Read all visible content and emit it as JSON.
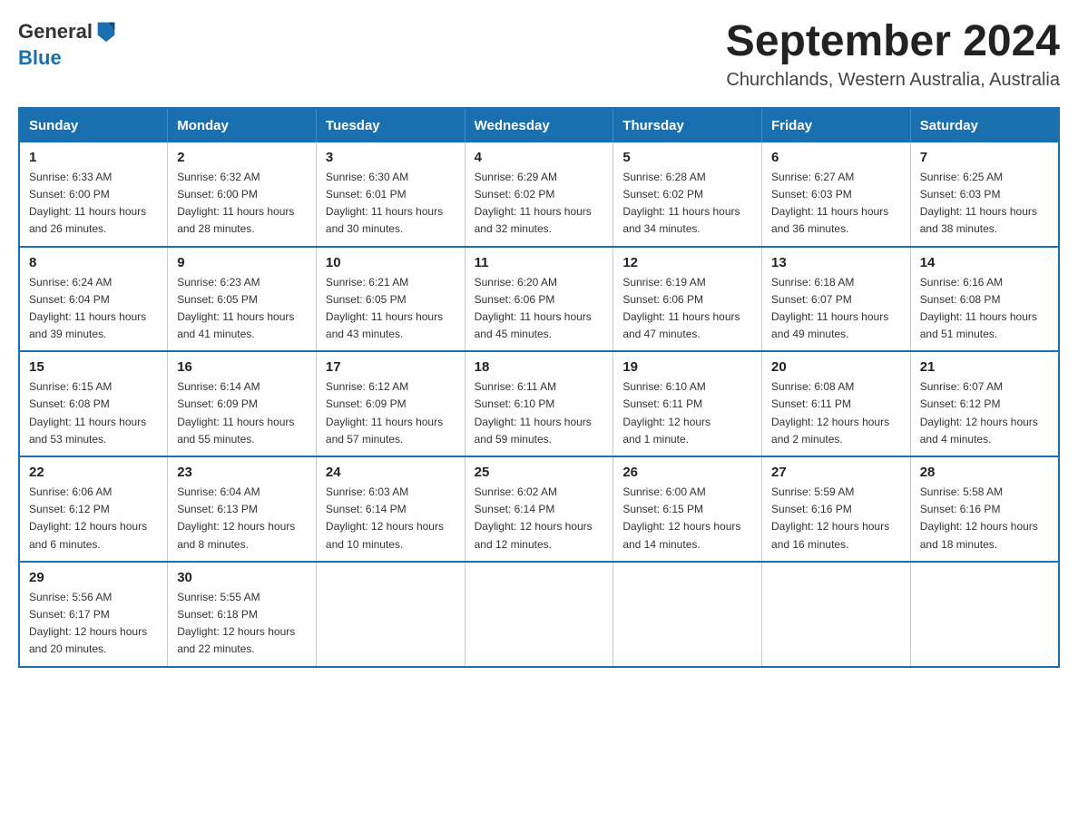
{
  "logo": {
    "text_general": "General",
    "text_blue": "Blue"
  },
  "title": "September 2024",
  "location": "Churchlands, Western Australia, Australia",
  "days_of_week": [
    "Sunday",
    "Monday",
    "Tuesday",
    "Wednesday",
    "Thursday",
    "Friday",
    "Saturday"
  ],
  "weeks": [
    [
      {
        "day": "1",
        "sunrise": "6:33 AM",
        "sunset": "6:00 PM",
        "daylight": "11 hours and 26 minutes."
      },
      {
        "day": "2",
        "sunrise": "6:32 AM",
        "sunset": "6:00 PM",
        "daylight": "11 hours and 28 minutes."
      },
      {
        "day": "3",
        "sunrise": "6:30 AM",
        "sunset": "6:01 PM",
        "daylight": "11 hours and 30 minutes."
      },
      {
        "day": "4",
        "sunrise": "6:29 AM",
        "sunset": "6:02 PM",
        "daylight": "11 hours and 32 minutes."
      },
      {
        "day": "5",
        "sunrise": "6:28 AM",
        "sunset": "6:02 PM",
        "daylight": "11 hours and 34 minutes."
      },
      {
        "day": "6",
        "sunrise": "6:27 AM",
        "sunset": "6:03 PM",
        "daylight": "11 hours and 36 minutes."
      },
      {
        "day": "7",
        "sunrise": "6:25 AM",
        "sunset": "6:03 PM",
        "daylight": "11 hours and 38 minutes."
      }
    ],
    [
      {
        "day": "8",
        "sunrise": "6:24 AM",
        "sunset": "6:04 PM",
        "daylight": "11 hours and 39 minutes."
      },
      {
        "day": "9",
        "sunrise": "6:23 AM",
        "sunset": "6:05 PM",
        "daylight": "11 hours and 41 minutes."
      },
      {
        "day": "10",
        "sunrise": "6:21 AM",
        "sunset": "6:05 PM",
        "daylight": "11 hours and 43 minutes."
      },
      {
        "day": "11",
        "sunrise": "6:20 AM",
        "sunset": "6:06 PM",
        "daylight": "11 hours and 45 minutes."
      },
      {
        "day": "12",
        "sunrise": "6:19 AM",
        "sunset": "6:06 PM",
        "daylight": "11 hours and 47 minutes."
      },
      {
        "day": "13",
        "sunrise": "6:18 AM",
        "sunset": "6:07 PM",
        "daylight": "11 hours and 49 minutes."
      },
      {
        "day": "14",
        "sunrise": "6:16 AM",
        "sunset": "6:08 PM",
        "daylight": "11 hours and 51 minutes."
      }
    ],
    [
      {
        "day": "15",
        "sunrise": "6:15 AM",
        "sunset": "6:08 PM",
        "daylight": "11 hours and 53 minutes."
      },
      {
        "day": "16",
        "sunrise": "6:14 AM",
        "sunset": "6:09 PM",
        "daylight": "11 hours and 55 minutes."
      },
      {
        "day": "17",
        "sunrise": "6:12 AM",
        "sunset": "6:09 PM",
        "daylight": "11 hours and 57 minutes."
      },
      {
        "day": "18",
        "sunrise": "6:11 AM",
        "sunset": "6:10 PM",
        "daylight": "11 hours and 59 minutes."
      },
      {
        "day": "19",
        "sunrise": "6:10 AM",
        "sunset": "6:11 PM",
        "daylight": "12 hours and 1 minute."
      },
      {
        "day": "20",
        "sunrise": "6:08 AM",
        "sunset": "6:11 PM",
        "daylight": "12 hours and 2 minutes."
      },
      {
        "day": "21",
        "sunrise": "6:07 AM",
        "sunset": "6:12 PM",
        "daylight": "12 hours and 4 minutes."
      }
    ],
    [
      {
        "day": "22",
        "sunrise": "6:06 AM",
        "sunset": "6:12 PM",
        "daylight": "12 hours and 6 minutes."
      },
      {
        "day": "23",
        "sunrise": "6:04 AM",
        "sunset": "6:13 PM",
        "daylight": "12 hours and 8 minutes."
      },
      {
        "day": "24",
        "sunrise": "6:03 AM",
        "sunset": "6:14 PM",
        "daylight": "12 hours and 10 minutes."
      },
      {
        "day": "25",
        "sunrise": "6:02 AM",
        "sunset": "6:14 PM",
        "daylight": "12 hours and 12 minutes."
      },
      {
        "day": "26",
        "sunrise": "6:00 AM",
        "sunset": "6:15 PM",
        "daylight": "12 hours and 14 minutes."
      },
      {
        "day": "27",
        "sunrise": "5:59 AM",
        "sunset": "6:16 PM",
        "daylight": "12 hours and 16 minutes."
      },
      {
        "day": "28",
        "sunrise": "5:58 AM",
        "sunset": "6:16 PM",
        "daylight": "12 hours and 18 minutes."
      }
    ],
    [
      {
        "day": "29",
        "sunrise": "5:56 AM",
        "sunset": "6:17 PM",
        "daylight": "12 hours and 20 minutes."
      },
      {
        "day": "30",
        "sunrise": "5:55 AM",
        "sunset": "6:18 PM",
        "daylight": "12 hours and 22 minutes."
      },
      null,
      null,
      null,
      null,
      null
    ]
  ],
  "labels": {
    "sunrise_prefix": "Sunrise: ",
    "sunset_prefix": "Sunset: ",
    "daylight_prefix": "Daylight: "
  }
}
